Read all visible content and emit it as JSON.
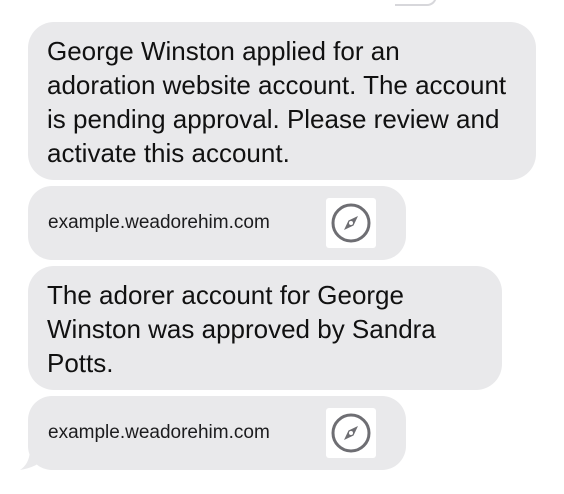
{
  "messages": [
    {
      "text": "George Winston applied for an adoration website account. The account is pending approval. Please review and activate this account.",
      "link": "example.weadorehim.com",
      "link_icon": "compass-icon"
    },
    {
      "text": "The adorer account for George Winston was approved by Sandra Potts.",
      "link": "example.weadorehim.com",
      "link_icon": "compass-icon"
    }
  ],
  "colors": {
    "bubble_bg": "#e9e9eb",
    "text": "#111111",
    "icon": "#6e6e73"
  }
}
